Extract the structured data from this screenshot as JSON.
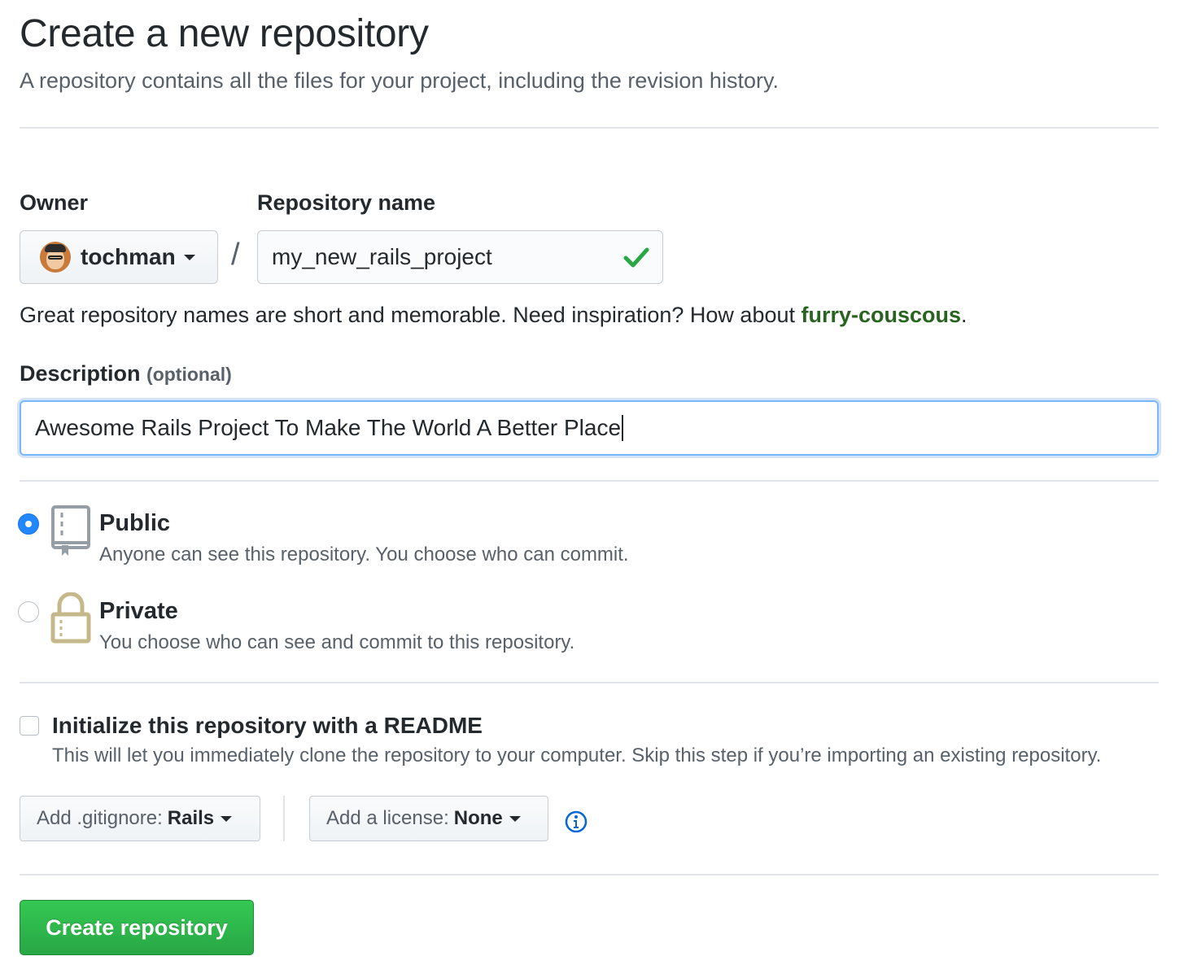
{
  "header": {
    "title": "Create a new repository",
    "subtitle": "A repository contains all the files for your project, including the revision history."
  },
  "owner": {
    "label": "Owner",
    "value": "tochman"
  },
  "repo_name": {
    "label": "Repository name",
    "value": "my_new_rails_project",
    "valid": true
  },
  "separator": "/",
  "name_hint": {
    "text": "Great repository names are short and memorable. Need inspiration? How about ",
    "suggestion": "furry-couscous",
    "suffix": "."
  },
  "description": {
    "label": "Description",
    "optional": "(optional)",
    "value": "Awesome Rails Project To Make The World A Better Place"
  },
  "visibility": {
    "selected": "public",
    "options": [
      {
        "id": "public",
        "title": "Public",
        "desc": "Anyone can see this repository. You choose who can commit."
      },
      {
        "id": "private",
        "title": "Private",
        "desc": "You choose who can see and commit to this repository."
      }
    ]
  },
  "readme": {
    "checked": false,
    "title": "Initialize this repository with a README",
    "desc": "This will let you immediately clone the repository to your computer. Skip this step if you’re importing an existing repository."
  },
  "gitignore": {
    "prefix": "Add .gitignore:",
    "value": "Rails"
  },
  "license": {
    "prefix": "Add a license:",
    "value": "None"
  },
  "icons": {
    "owner_caret": "caret-down-icon",
    "valid": "check-icon",
    "public": "repo-book-icon",
    "private": "lock-icon",
    "info": "info-icon"
  },
  "colors": {
    "accent_blue": "#2188ff",
    "success_green": "#28a745",
    "suggestion_green": "#28641f",
    "lock_tan": "#c5b88a"
  },
  "submit": {
    "label": "Create repository"
  }
}
